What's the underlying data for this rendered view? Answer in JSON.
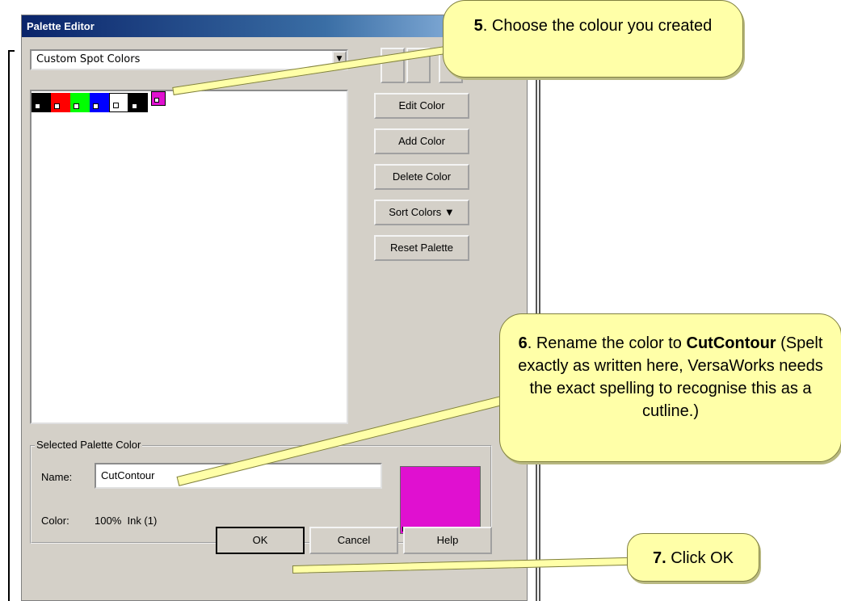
{
  "dialog": {
    "title": "Palette Editor",
    "palette_select": "Custom Spot Colors",
    "buttons": {
      "edit": "Edit Color",
      "add": "Add Color",
      "delete": "Delete Color",
      "sort": "Sort Colors ▼",
      "reset": "Reset Palette"
    },
    "swatches": [
      {
        "color": "#000000"
      },
      {
        "color": "#ff0000"
      },
      {
        "color": "#00ff00"
      },
      {
        "color": "#0000ff"
      },
      {
        "color": "#ffffff"
      },
      {
        "color": "#000000"
      },
      {
        "color": "#e010d0",
        "selected": true
      }
    ],
    "selected": {
      "group_label": "Selected Palette Color",
      "name_label": "Name:",
      "name_value": "CutContour",
      "color_label": "Color:",
      "color_value": "100%  Ink (1)",
      "preview_color": "#e010d0"
    },
    "footer": {
      "ok": "OK",
      "cancel": "Cancel",
      "help": "Help"
    }
  },
  "callouts": {
    "c5": {
      "num": "5",
      "text": ". Choose the colour you created"
    },
    "c6": {
      "num": "6",
      "text1": ". Rename the color to ",
      "bold": "CutContour",
      "text2": " (Spelt exactly as written here, VersaWorks needs the exact spelling to recognise this as a cutline.)"
    },
    "c7": {
      "num": "7.",
      "text": " Click OK"
    }
  },
  "colors": {
    "callout_fill": "#ffffa8",
    "title_bar": "#0a246a",
    "magenta": "#e010d0"
  }
}
